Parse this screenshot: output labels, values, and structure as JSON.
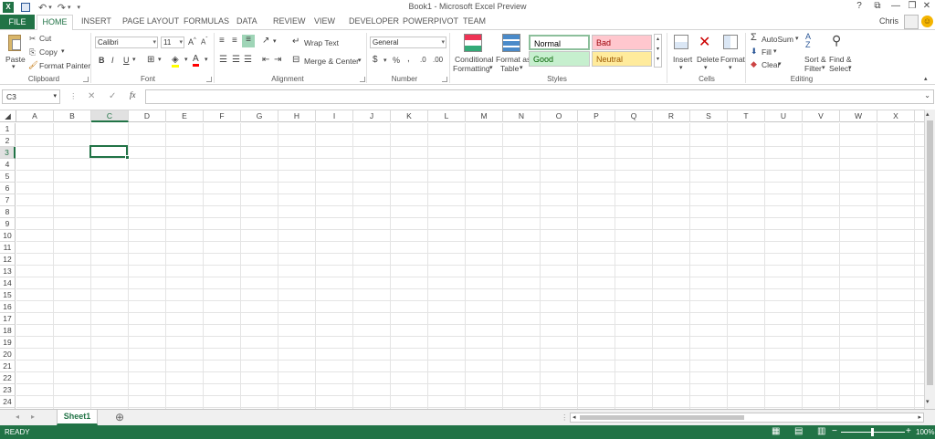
{
  "window": {
    "title": "Book1 - Microsoft Excel Preview",
    "help": "?",
    "restore_ribbon": "⧉",
    "minimize": "—",
    "restore": "❐",
    "close": "✕"
  },
  "tabs": {
    "file": "FILE",
    "items": [
      "HOME",
      "INSERT",
      "PAGE LAYOUT",
      "FORMULAS",
      "DATA",
      "REVIEW",
      "VIEW",
      "DEVELOPER",
      "POWERPIVOT",
      "TEAM"
    ]
  },
  "user": {
    "name": "Chris"
  },
  "ribbon": {
    "clipboard": {
      "label": "Clipboard",
      "paste": "Paste",
      "cut": "Cut",
      "copy": "Copy",
      "format_painter": "Format Painter"
    },
    "font": {
      "label": "Font",
      "name": "Calibri",
      "size": "11",
      "bold": "B",
      "italic": "I",
      "underline": "U"
    },
    "alignment": {
      "label": "Alignment",
      "wrap": "Wrap Text",
      "merge": "Merge & Center"
    },
    "number": {
      "label": "Number",
      "format": "General",
      "percent": "%",
      "comma": ","
    },
    "styles": {
      "label": "Styles",
      "cond1": "Conditional",
      "cond2": "Formatting",
      "fmt1": "Format as",
      "fmt2": "Table",
      "normal": "Normal",
      "bad": "Bad",
      "good": "Good",
      "neutral": "Neutral"
    },
    "cells": {
      "label": "Cells",
      "insert": "Insert",
      "delete": "Delete",
      "format": "Format"
    },
    "editing": {
      "label": "Editing",
      "autosum": "AutoSum",
      "fill": "Fill",
      "clear": "Clear",
      "sort1": "Sort &",
      "sort2": "Filter",
      "find1": "Find &",
      "find2": "Select"
    }
  },
  "formula_bar": {
    "name_box": "C3",
    "fx": "fx",
    "cancel": "✕",
    "enter": "✓",
    "value": ""
  },
  "grid": {
    "columns": [
      "A",
      "B",
      "C",
      "D",
      "E",
      "F",
      "G",
      "H",
      "I",
      "J",
      "K",
      "L",
      "M",
      "N",
      "O",
      "P",
      "Q",
      "R",
      "S",
      "T",
      "U",
      "V",
      "W",
      "X"
    ],
    "rows": [
      "1",
      "2",
      "3",
      "4",
      "5",
      "6",
      "7",
      "8",
      "9",
      "10",
      "11",
      "12",
      "13",
      "14",
      "15",
      "16",
      "17",
      "18",
      "19",
      "20",
      "21",
      "22",
      "23",
      "24",
      "25"
    ],
    "active_column": "C",
    "active_row": "3"
  },
  "sheets": {
    "tabs": [
      "Sheet1"
    ],
    "add": "⊕"
  },
  "status": {
    "text": "READY",
    "zoom": "100%",
    "minus": "−",
    "plus": "+"
  },
  "colors": {
    "accent": "#217346",
    "bad_bg": "#ffc7ce",
    "bad_fg": "#9c0006",
    "good_bg": "#c6efce",
    "good_fg": "#006100",
    "neutral_bg": "#ffeb9c",
    "neutral_fg": "#9c5700"
  }
}
